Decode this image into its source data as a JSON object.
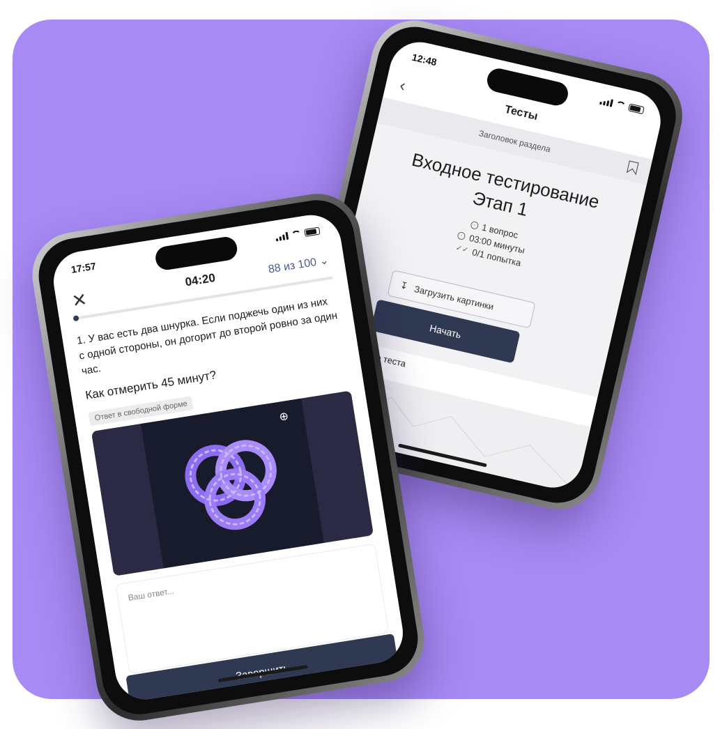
{
  "colors": {
    "background": "#a78af4",
    "button": "#2f3a52",
    "accent_text": "#4a5a8a"
  },
  "right_phone": {
    "status_time": "12:48",
    "nav_title": "Тесты",
    "section_header": "Заголовок раздела",
    "heading_line1": "Входное тестирование",
    "heading_line2": "Этап 1",
    "meta": {
      "questions": "1 вопрос",
      "duration": "03:00 минуты",
      "attempts": "0/1 попытка"
    },
    "upload_label": "Загрузить картинки",
    "start_label": "Начать",
    "description_label": "Описание теста"
  },
  "left_phone": {
    "status_time": "17:57",
    "timer": "04:20",
    "progress_text": "88 из 100",
    "progress_fraction": 0.01,
    "question_text": "1. У вас есть два шнурка. Если поджечь один из них с одной стороны, он догорит до второй ровно за один час.",
    "question_prompt": "Как отмерить 45 минут?",
    "answer_type_badge": "Ответ в свободной форме",
    "answer_placeholder": "Ваш ответ...",
    "finish_label": "Завершить"
  },
  "icons": [
    "back-chevron-icon",
    "bookmark-icon",
    "target-icon",
    "clock-icon",
    "double-check-icon",
    "download-icon",
    "close-icon",
    "chevron-down-icon",
    "zoom-in-icon"
  ]
}
